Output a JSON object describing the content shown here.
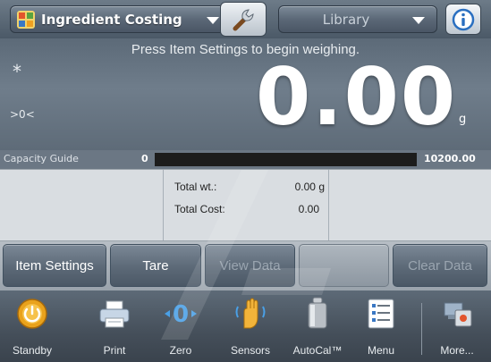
{
  "header": {
    "app_title": "Ingredient Costing",
    "app_icon": "ingredient-costing-icon",
    "library_label": "Library",
    "settings_icon": "wrench-icon",
    "info_icon": "info-icon"
  },
  "display": {
    "prompt": "Press Item Settings to begin weighing.",
    "stable_indicator": "*",
    "zero_indicator": ">0<",
    "reading": "0.00",
    "unit": "g"
  },
  "capacity_guide": {
    "label": "Capacity Guide",
    "min": "0",
    "max": "10200.00",
    "fill_fraction": 0
  },
  "reference": {
    "total_wt_label": "Total wt.:",
    "total_wt_value": "0.00 g",
    "total_cost_label": "Total Cost:",
    "total_cost_value": "0.00"
  },
  "softkeys": {
    "item_settings": "Item Settings",
    "tare": "Tare",
    "view_data": "View Data",
    "clear_data": "Clear Data"
  },
  "nav": {
    "items": [
      {
        "label": "Standby",
        "icon": "standby-icon"
      },
      {
        "label": "Print",
        "icon": "printer-icon"
      },
      {
        "label": "Zero",
        "icon": "zero-icon"
      },
      {
        "label": "Sensors",
        "icon": "hand-sensor-icon"
      },
      {
        "label": "AutoCal™",
        "icon": "calibration-weight-icon"
      },
      {
        "label": "Menu",
        "icon": "menu-icon"
      },
      {
        "label": "More...",
        "icon": "more-icon"
      }
    ]
  },
  "colors": {
    "accent_orange": "#f0a020",
    "info_blue": "#2a6fc0",
    "bar_dark": "#1c1c1c"
  }
}
